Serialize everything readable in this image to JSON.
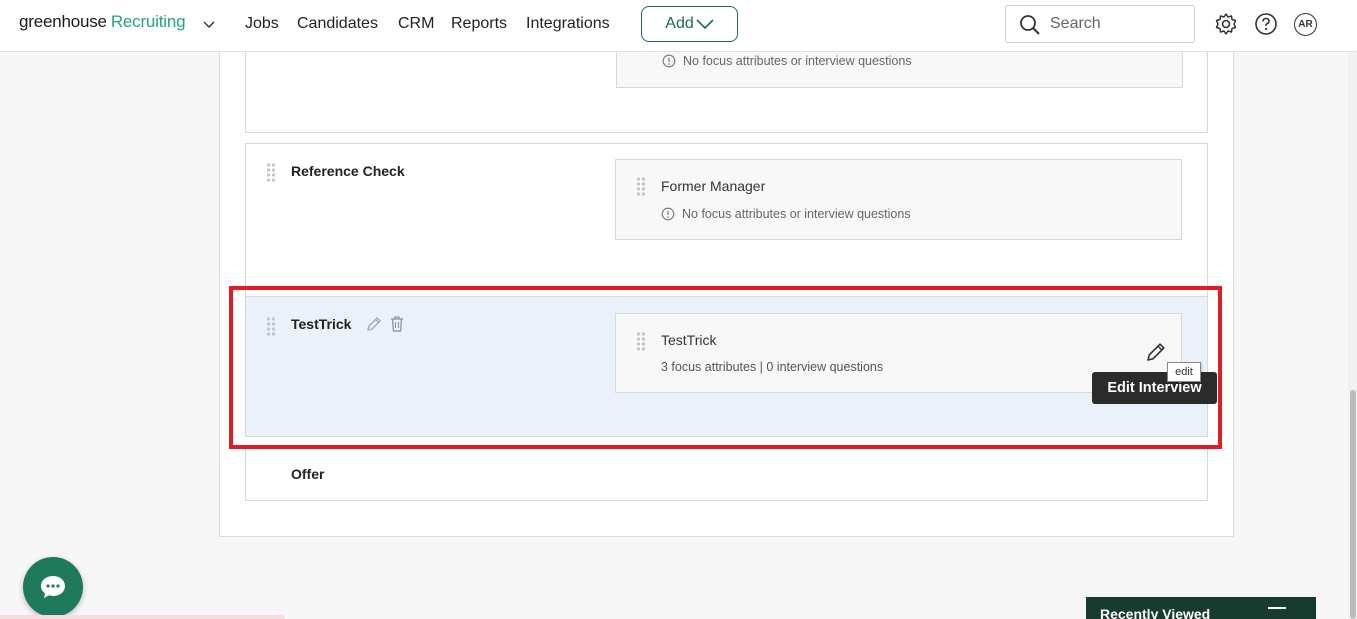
{
  "brand": {
    "name": "greenhouse",
    "product": "Recruiting"
  },
  "nav": {
    "links": [
      "Jobs",
      "Candidates",
      "CRM",
      "Reports",
      "Integrations"
    ],
    "add_label": "Add",
    "search_placeholder": "Search",
    "avatar_initials": "AR"
  },
  "stages": [
    {
      "name": "",
      "interviews": [
        {
          "name": "",
          "note": "No focus attributes or interview questions"
        }
      ]
    },
    {
      "name": "Reference Check",
      "interviews": [
        {
          "name": "Former Manager",
          "note": "No focus attributes or interview questions"
        }
      ]
    },
    {
      "name": "TestTrick",
      "interviews": [
        {
          "name": "TestTrick",
          "summary": "3 focus attributes | 0 interview questions"
        }
      ]
    },
    {
      "name": "Offer",
      "interviews": []
    }
  ],
  "tooltips": {
    "edit": "edit",
    "edit_interview": "Edit Interview"
  },
  "recently_viewed": {
    "title": "Recently Viewed"
  },
  "colors": {
    "brand_green": "#24a47f",
    "highlight_red": "#e11c24",
    "active_stage": "#eaf1fa"
  }
}
